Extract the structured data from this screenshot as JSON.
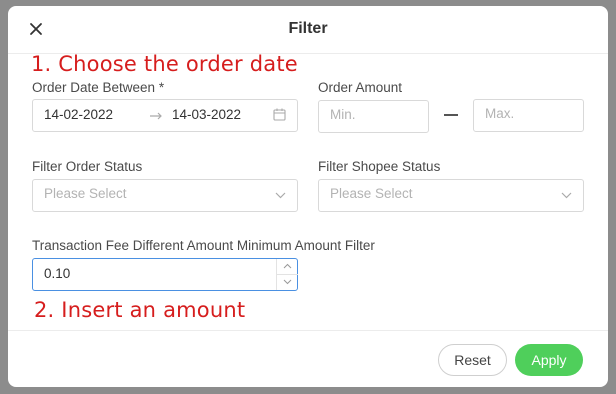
{
  "dialog": {
    "title": "Filter",
    "close_icon": "close-icon"
  },
  "annotations": {
    "step1": "1. Choose the order date",
    "step2": "2. Insert an amount"
  },
  "order_date": {
    "label": "Order Date Between *",
    "start": "14-02-2022",
    "end": "14-03-2022",
    "arrow_icon": "arrow-right-icon",
    "calendar_icon": "calendar-icon"
  },
  "order_amount": {
    "label": "Order Amount",
    "min_placeholder": "Min.",
    "max_placeholder": "Max."
  },
  "order_status": {
    "label": "Filter Order Status",
    "placeholder": "Please Select"
  },
  "shopee_status": {
    "label": "Filter Shopee Status",
    "placeholder": "Please Select"
  },
  "transaction_fee": {
    "label": "Transaction Fee Different Amount Minimum Amount Filter",
    "value": "0.10"
  },
  "buttons": {
    "reset": "Reset",
    "apply": "Apply"
  },
  "colors": {
    "apply": "#4fcf5b",
    "annotation": "#d61d1d",
    "focus_border": "#4a90e2"
  }
}
